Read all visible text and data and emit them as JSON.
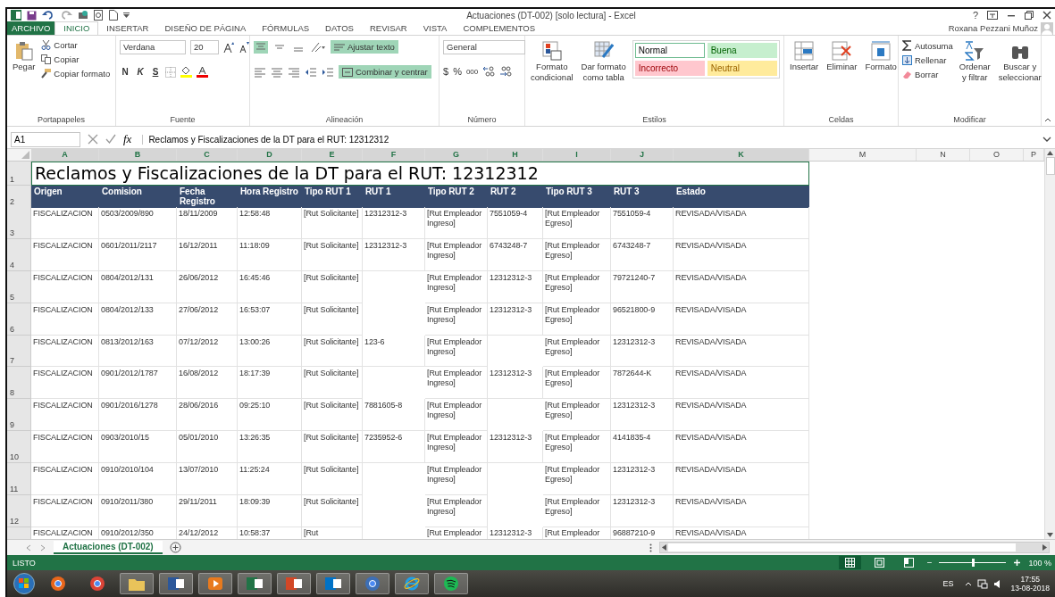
{
  "window": {
    "title": "Actuaciones (DT-002)  [solo lectura] - Excel",
    "help": "?"
  },
  "ribbon": {
    "tabs": [
      {
        "label": "ARCHIVO",
        "kind": "file",
        "selected": false
      },
      {
        "label": "INICIO",
        "kind": "tab",
        "selected": true
      },
      {
        "label": "INSERTAR",
        "kind": "tab",
        "selected": false
      },
      {
        "label": "DISEÑO DE PÁGINA",
        "kind": "tab",
        "selected": false
      },
      {
        "label": "FÓRMULAS",
        "kind": "tab",
        "selected": false
      },
      {
        "label": "DATOS",
        "kind": "tab",
        "selected": false
      },
      {
        "label": "REVISAR",
        "kind": "tab",
        "selected": false
      },
      {
        "label": "VISTA",
        "kind": "tab",
        "selected": false
      },
      {
        "label": "COMPLEMENTOS",
        "kind": "tab",
        "selected": false
      }
    ],
    "user": "Roxana Pezzani Muñoz",
    "clipboard": {
      "label": "Portapapeles",
      "paste": "Pegar",
      "cut": "Cortar",
      "copy": "Copiar",
      "format_painter": "Copiar formato"
    },
    "font": {
      "label": "Fuente",
      "family": "Verdana",
      "size": "20",
      "bold": "N",
      "italic": "K",
      "underline": "S"
    },
    "alignment": {
      "label": "Alineación",
      "align_top": {
        "on": true
      },
      "wrap_text": {
        "label": "Ajustar texto",
        "on": true
      },
      "merge_center": {
        "label": "Combinar y centrar",
        "on": true
      }
    },
    "number": {
      "label": "Número",
      "format": "General",
      "currency": "$",
      "percent": "%",
      "thousands": "000"
    },
    "styles": {
      "label": "Estilos",
      "conditional": [
        "Formato",
        "condicional"
      ],
      "as_table": [
        "Dar formato",
        "como tabla"
      ],
      "cell_styles": [
        {
          "label": "Normal",
          "kind": "normal",
          "selected": true
        },
        {
          "label": "Buena",
          "kind": "good",
          "selected": false
        },
        {
          "label": "Incorrecto",
          "kind": "bad",
          "selected": false
        },
        {
          "label": "Neutral",
          "kind": "neutral",
          "selected": false
        }
      ]
    },
    "cells": {
      "label": "Celdas",
      "insert": "Insertar",
      "delete": "Eliminar",
      "format": "Formato"
    },
    "editing": {
      "label": "Modificar",
      "autosum": "Autosuma",
      "fill": "Rellenar",
      "clear": "Borrar",
      "sort_filter": [
        "Ordenar",
        "y filtrar"
      ],
      "find_select": [
        "Buscar y",
        "seleccionar"
      ]
    }
  },
  "formula_bar": {
    "name_box": "A1",
    "fx": "fx",
    "content": "Reclamos y Fiscalizaciones de la DT para el RUT: 12312312"
  },
  "sheet": {
    "columns": [
      {
        "letter": "A",
        "selected": true
      },
      {
        "letter": "B",
        "selected": true
      },
      {
        "letter": "C",
        "selected": true
      },
      {
        "letter": "D",
        "selected": true
      },
      {
        "letter": "E",
        "selected": true
      },
      {
        "letter": "F",
        "selected": true
      },
      {
        "letter": "G",
        "selected": true
      },
      {
        "letter": "H",
        "selected": true
      },
      {
        "letter": "I",
        "selected": true
      },
      {
        "letter": "J",
        "selected": true
      },
      {
        "letter": "K",
        "selected": true
      },
      {
        "letter": "M",
        "selected": false
      },
      {
        "letter": "N",
        "selected": false
      },
      {
        "letter": "O",
        "selected": false
      },
      {
        "letter": "P",
        "selected": false
      }
    ],
    "title_row": {
      "number": "1",
      "text": "Reclamos y Fiscalizaciones de la DT para el RUT: 12312312"
    },
    "header_row": {
      "number": "2",
      "cells": {
        "A": "Origen",
        "B": "Comision",
        "C": "Fecha Registro",
        "D": "Hora Registro",
        "E": "Tipo RUT 1",
        "F": "RUT 1",
        "G": "Tipo RUT 2",
        "H": "RUT 2",
        "I": "Tipo RUT 3",
        "J": "RUT 3",
        "K": "Estado"
      }
    },
    "rows": [
      {
        "number": "3",
        "cells": {
          "A": "FISCALIZACION",
          "B": "0503/2009/890",
          "C": "18/11/2009",
          "D": "12:58:48",
          "E": "[Rut Solicitante]",
          "F": "12312312-3",
          "G": "[Rut Empleador Ingreso]",
          "H": "7551059-4",
          "I": "[Rut Empleador Egreso]",
          "J": "7551059-4",
          "K": "REVISADA/VISADA"
        }
      },
      {
        "number": "4",
        "cells": {
          "A": "FISCALIZACION",
          "B": "0601/2011/2117",
          "C": "16/12/2011",
          "D": "11:18:09",
          "E": "[Rut Solicitante]",
          "F": "12312312-3",
          "G": "[Rut Empleador Ingreso]",
          "H": "6743248-7",
          "I": "[Rut Empleador Egreso]",
          "J": "6743248-7",
          "K": "REVISADA/VISADA"
        }
      },
      {
        "number": "5",
        "cells": {
          "A": "FISCALIZACION",
          "B": "0804/2012/131",
          "C": "26/06/2012",
          "D": "16:45:46",
          "E": "[Rut Solicitante]",
          "G": "[Rut Empleador Ingreso]",
          "H": "12312312-3",
          "I": "[Rut Empleador Egreso]",
          "J": "79721240-7",
          "K": "REVISADA/VISADA"
        }
      },
      {
        "number": "6",
        "cells": {
          "A": "FISCALIZACION",
          "B": "0804/2012/133",
          "C": "27/06/2012",
          "D": "16:53:07",
          "E": "[Rut Solicitante]",
          "G": "[Rut Empleador Ingreso]",
          "H": "12312312-3",
          "I": "[Rut Empleador Egreso]",
          "J": "96521800-9",
          "K": "REVISADA/VISADA"
        }
      },
      {
        "number": "7",
        "cells": {
          "A": "FISCALIZACION",
          "B": "0813/2012/163",
          "C": "07/12/2012",
          "D": "13:00:26",
          "E": "[Rut Solicitante]",
          "F": "123-6",
          "G": "[Rut Empleador Ingreso]",
          "I": "[Rut Empleador Egreso]",
          "J": "12312312-3",
          "K": "REVISADA/VISADA"
        }
      },
      {
        "number": "8",
        "cells": {
          "A": "FISCALIZACION",
          "B": "0901/2012/1787",
          "C": "16/08/2012",
          "D": "18:17:39",
          "E": "[Rut Solicitante]",
          "G": "[Rut Empleador Ingreso]",
          "H": "12312312-3",
          "I": "[Rut Empleador Egreso]",
          "J": "7872644-K",
          "K": "REVISADA/VISADA"
        }
      },
      {
        "number": "9",
        "cells": {
          "A": "FISCALIZACION",
          "B": "0901/2016/1278",
          "C": "28/06/2016",
          "D": "09:25:10",
          "E": "[Rut Solicitante]",
          "F": "7881605-8",
          "G": "[Rut Empleador Ingreso]",
          "I": "[Rut Empleador Egreso]",
          "J": "12312312-3",
          "K": "REVISADA/VISADA"
        }
      },
      {
        "number": "10",
        "cells": {
          "A": "FISCALIZACION",
          "B": "0903/2010/15",
          "C": "05/01/2010",
          "D": "13:26:35",
          "E": "[Rut Solicitante]",
          "F": "7235952-6",
          "G": "[Rut Empleador Ingreso]",
          "H": "12312312-3",
          "I": "[Rut Empleador Egreso]",
          "J": "4141835-4",
          "K": "REVISADA/VISADA"
        }
      },
      {
        "number": "11",
        "cells": {
          "A": "FISCALIZACION",
          "B": "0910/2010/104",
          "C": "13/07/2010",
          "D": "11:25:24",
          "E": "[Rut Solicitante]",
          "G": "[Rut Empleador Ingreso]",
          "I": "[Rut Empleador Egreso]",
          "J": "12312312-3",
          "K": "REVISADA/VISADA"
        }
      },
      {
        "number": "12",
        "cells": {
          "A": "FISCALIZACION",
          "B": "0910/2011/380",
          "C": "29/11/2011",
          "D": "18:09:39",
          "E": "[Rut Solicitante]",
          "G": "[Rut Empleador Ingreso]",
          "I": "[Rut Empleador Egreso]",
          "J": "12312312-3",
          "K": "REVISADA/VISADA"
        }
      },
      {
        "cells": {
          "A": "FISCALIZACION",
          "B": "0910/2012/350",
          "C": "24/12/2012",
          "D": "10:58:37",
          "E": "[Rut",
          "G": "[Rut Empleador",
          "H": "12312312-3",
          "I": "[Rut Empleador",
          "J": "96887210-9",
          "K": "REVISADA/VISADA"
        }
      }
    ],
    "tabs": [
      {
        "label": "Actuaciones (DT-002)",
        "selected": true
      }
    ]
  },
  "status_bar": {
    "text": "LISTO",
    "views": [
      {
        "kind": "normal",
        "selected": true
      },
      {
        "kind": "layout",
        "selected": false
      },
      {
        "kind": "pagebreak",
        "selected": false
      }
    ],
    "zoom": {
      "level": 0.5
    },
    "zoom_out": "−",
    "zoom_text": "100 %"
  },
  "taskbar": {
    "apps": [
      {
        "kind": "fox",
        "running": false
      },
      {
        "kind": "wheel",
        "running": false
      },
      {
        "kind": "folder",
        "running": true
      },
      {
        "kind": "document",
        "running": true
      },
      {
        "kind": "player",
        "running": true
      },
      {
        "kind": "spreadsheet",
        "running": true
      },
      {
        "kind": "slides",
        "running": true
      },
      {
        "kind": "mail",
        "running": true
      },
      {
        "kind": "bird",
        "running": true
      },
      {
        "kind": "browser",
        "running": true
      },
      {
        "kind": "music",
        "running": true
      }
    ],
    "language": "ES",
    "time": "17:55",
    "date": "13-08-2018"
  }
}
